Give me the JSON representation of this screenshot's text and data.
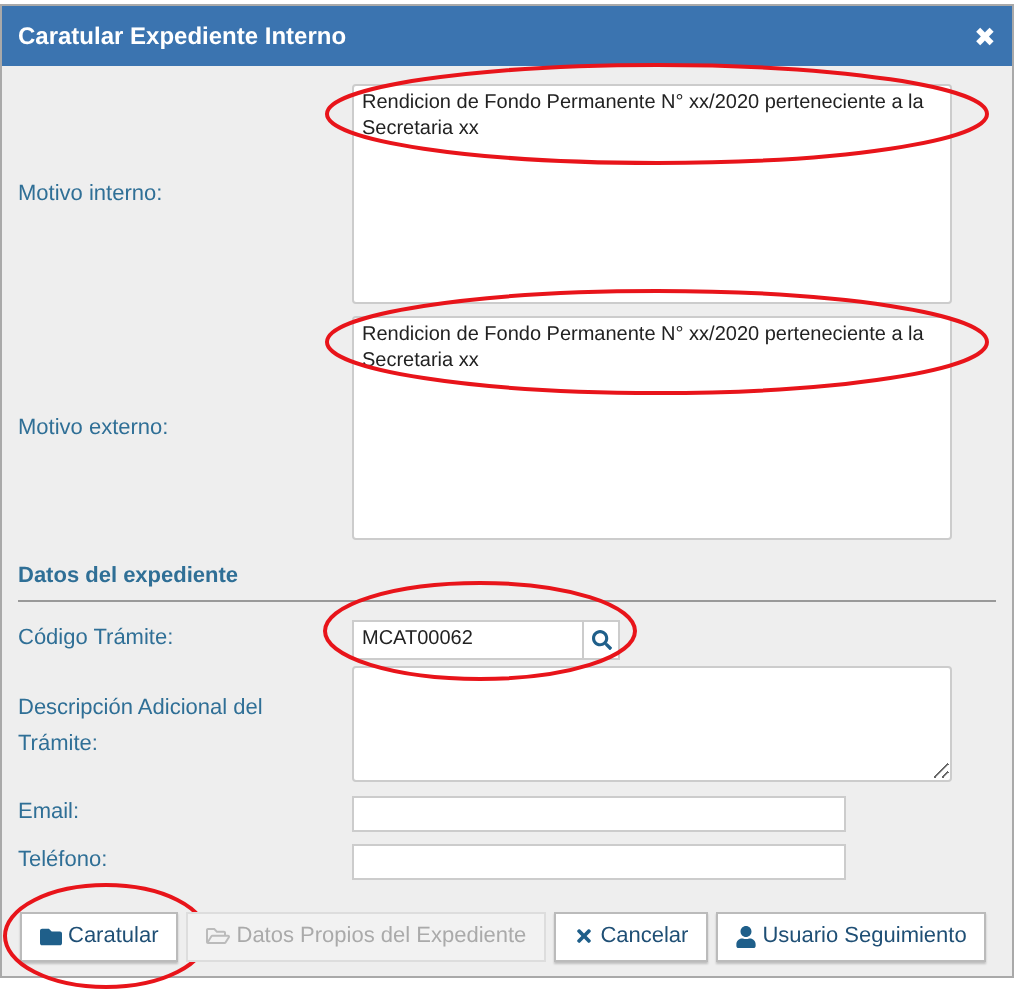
{
  "dialog": {
    "title": "Caratular Expediente Interno",
    "close_glyph": "✖"
  },
  "motivos": [
    {
      "label": "Motivo interno:",
      "value": "Rendicion de Fondo Permanente N° xx/2020 perteneciente a la Secretaria xx",
      "highlighted": true
    },
    {
      "label": "Motivo externo:",
      "value": "Rendicion de Fondo Permanente N° xx/2020 perteneciente a la Secretaria xx",
      "highlighted": true
    }
  ],
  "section": {
    "title": "Datos del expediente"
  },
  "codigo": {
    "label": "Código Trámite:",
    "value": "MCAT00062",
    "highlighted": true
  },
  "descripcion": {
    "label": "Descripción Adicional del Trámite:"
  },
  "email": {
    "label": "Email:"
  },
  "telefono": {
    "label": "Teléfono:"
  },
  "buttons": [
    {
      "label": "Caratular",
      "kind": "folder",
      "disabled": false,
      "highlighted": true
    },
    {
      "label": "Datos Propios del Expediente",
      "kind": "folder-open",
      "disabled": true,
      "highlighted": false
    },
    {
      "label": "Cancelar",
      "kind": "close",
      "disabled": false,
      "highlighted": false
    },
    {
      "label": "Usuario Seguimiento",
      "kind": "user",
      "disabled": false,
      "highlighted": false
    }
  ]
}
